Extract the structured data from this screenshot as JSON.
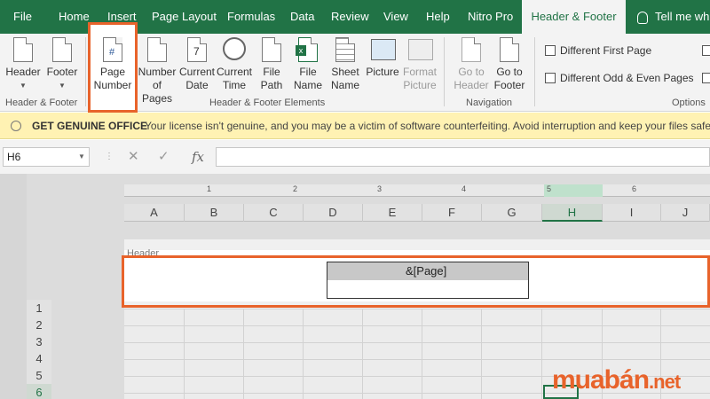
{
  "tabs": [
    {
      "label": "File",
      "active": false
    },
    {
      "label": "Home",
      "active": false
    },
    {
      "label": "Insert",
      "active": false
    },
    {
      "label": "Page Layout",
      "active": false
    },
    {
      "label": "Formulas",
      "active": false
    },
    {
      "label": "Data",
      "active": false
    },
    {
      "label": "Review",
      "active": false
    },
    {
      "label": "View",
      "active": false
    },
    {
      "label": "Help",
      "active": false
    },
    {
      "label": "Nitro Pro",
      "active": false
    },
    {
      "label": "Header & Footer",
      "active": true
    }
  ],
  "tell_me": "Tell me wh",
  "ribbon": {
    "header_btn": "Header",
    "footer_btn": "Footer",
    "group1_label": "Header & Footer",
    "page_number": [
      "Page",
      "Number"
    ],
    "number_of_pages": [
      "Number",
      "of Pages"
    ],
    "current_date": [
      "Current",
      "Date"
    ],
    "current_time": [
      "Current",
      "Time"
    ],
    "file_path": [
      "File",
      "Path"
    ],
    "file_name": [
      "File",
      "Name"
    ],
    "sheet_name": [
      "Sheet",
      "Name"
    ],
    "picture": [
      "Picture",
      ""
    ],
    "format_picture": [
      "Format",
      "Picture"
    ],
    "group2_label": "Header & Footer Elements",
    "go_to_header": [
      "Go to",
      "Header"
    ],
    "go_to_footer": [
      "Go to",
      "Footer"
    ],
    "group3_label": "Navigation",
    "diff_first_page": "Different First Page",
    "diff_odd_even": "Different Odd & Even Pages",
    "group4_label": "Options"
  },
  "warning": {
    "title": "GET GENUINE OFFICE",
    "message": "Your license isn't genuine, and you may be a victim of software counterfeiting. Avoid interruption and keep your files safe"
  },
  "formula_bar": {
    "name_box": "H6",
    "cancel_icon": "✕",
    "enter_icon": "✓",
    "fx_label": "fx"
  },
  "sheet": {
    "ruler_marks": [
      "1",
      "2",
      "3",
      "4",
      "5",
      "6"
    ],
    "columns": [
      "A",
      "B",
      "C",
      "D",
      "E",
      "F",
      "G",
      "H",
      "I",
      "J"
    ],
    "selected_column": "H",
    "rows": [
      "1",
      "2",
      "3",
      "4",
      "5",
      "6"
    ],
    "selected_row": "6",
    "header_label": "Header",
    "header_code": "&[Page]"
  },
  "watermark": {
    "main": "muabán",
    "suffix": ".net"
  },
  "colors": {
    "excel_green": "#217346",
    "highlight_orange": "#e8632b",
    "warning_bg": "#fff2b3"
  }
}
